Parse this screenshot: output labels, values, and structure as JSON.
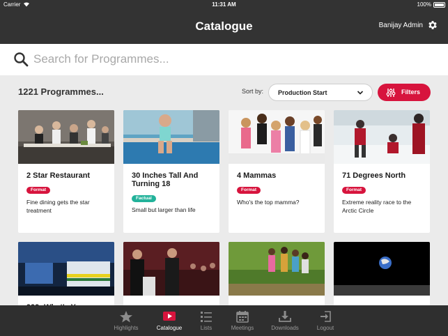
{
  "status_bar": {
    "carrier": "Carrier",
    "time": "11:31 AM",
    "battery": "100%"
  },
  "navbar": {
    "title": "Catalogue",
    "user": "Banijay Admin"
  },
  "search": {
    "placeholder": "Search for Programmes..."
  },
  "toolbar": {
    "count": "1221 Programmes...",
    "sort_label": "Sort by:",
    "sort_value": "Production Start",
    "filters_label": "Filters"
  },
  "colors": {
    "accent": "#d7143d",
    "format_badge": "#d7143d",
    "factual_badge": "#22b29a",
    "bar": "#333333"
  },
  "programmes": [
    {
      "title": "2 Star Restaurant",
      "badge": "Format",
      "badge_type": "format",
      "description": "Fine dining gets the star treatment"
    },
    {
      "title": "30 Inches Tall And Turning 18",
      "badge": "Factual",
      "badge_type": "factual",
      "description": "Small but larger than life"
    },
    {
      "title": "4 Mammas",
      "badge": "Format",
      "badge_type": "format",
      "description": "Who's the top mamma?"
    },
    {
      "title": "71 Degrees North",
      "badge": "Format",
      "badge_type": "format",
      "description": "Extreme reality race to the Arctic Circle"
    }
  ],
  "tabs": [
    {
      "label": "Highlights",
      "icon": "star-icon",
      "active": false
    },
    {
      "label": "Catalogue",
      "icon": "play-icon",
      "active": true
    },
    {
      "label": "Lists",
      "icon": "list-icon",
      "active": false
    },
    {
      "label": "Meetings",
      "icon": "calendar-icon",
      "active": false
    },
    {
      "label": "Downloads",
      "icon": "download-icon",
      "active": false
    },
    {
      "label": "Logout",
      "icon": "logout-icon",
      "active": false
    }
  ]
}
